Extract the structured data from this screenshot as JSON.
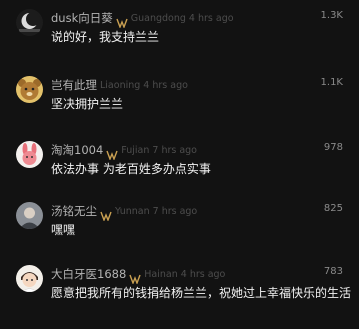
{
  "comments": [
    {
      "username": "dusk向日葵",
      "has_badge": true,
      "location": "Guangdong",
      "time": "4 hrs ago",
      "text": "说的好，我支持兰兰",
      "likes": "1.3K",
      "avatar_icon": "moon-night-avatar"
    },
    {
      "username": "岂有此理",
      "has_badge": false,
      "location": "Liaoning",
      "time": "4 hrs ago",
      "text": "坚决拥护兰兰",
      "likes": "1.1K",
      "avatar_icon": "cartoon-bear-avatar"
    },
    {
      "username": "淘淘1004",
      "has_badge": true,
      "location": "Fujian",
      "time": "7 hrs ago",
      "text": "依法办事 为老百姓多办点实事",
      "likes": "978",
      "avatar_icon": "pink-bunny-avatar"
    },
    {
      "username": "汤铭无尘",
      "has_badge": true,
      "location": "Yunnan",
      "time": "7 hrs ago",
      "text": "嘿嘿",
      "likes": "825",
      "avatar_icon": "person-photo-avatar"
    },
    {
      "username": "大白牙医1688",
      "has_badge": true,
      "location": "Hainan",
      "time": "4 hrs ago",
      "text": "愿意把我所有的钱捐给杨兰兰，祝她过上幸福快乐的生活",
      "likes": "783",
      "avatar_icon": "chibi-doctor-avatar"
    }
  ],
  "colors": {
    "background": "#121212",
    "username": "#b3b3b3",
    "meta": "#4d4d4d",
    "badge": "#c9a052"
  }
}
